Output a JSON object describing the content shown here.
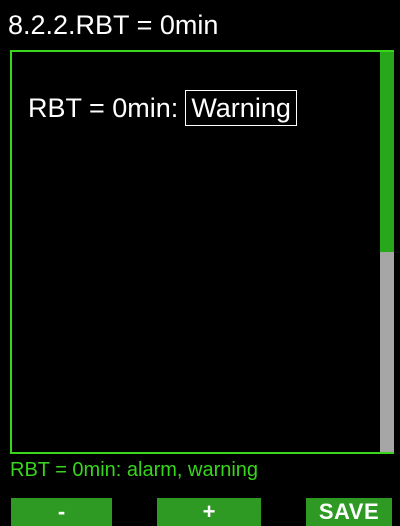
{
  "header": {
    "title": "8.2.2.RBT = 0min"
  },
  "main": {
    "setting_label": "RBT = 0min:",
    "setting_value": "Warning",
    "scroll_fraction_visible": 0.5
  },
  "status": {
    "text": "RBT = 0min: alarm, warning"
  },
  "softkeys": {
    "left_label": "-",
    "middle_label": "+",
    "right_label": "SAVE"
  },
  "colors": {
    "accent": "#37d61c",
    "softkey_bg": "#2e9a24",
    "scroll_thumb": "#27a81b",
    "scroll_track": "#a6a6a6",
    "background": "#000000",
    "text": "#ffffff"
  }
}
